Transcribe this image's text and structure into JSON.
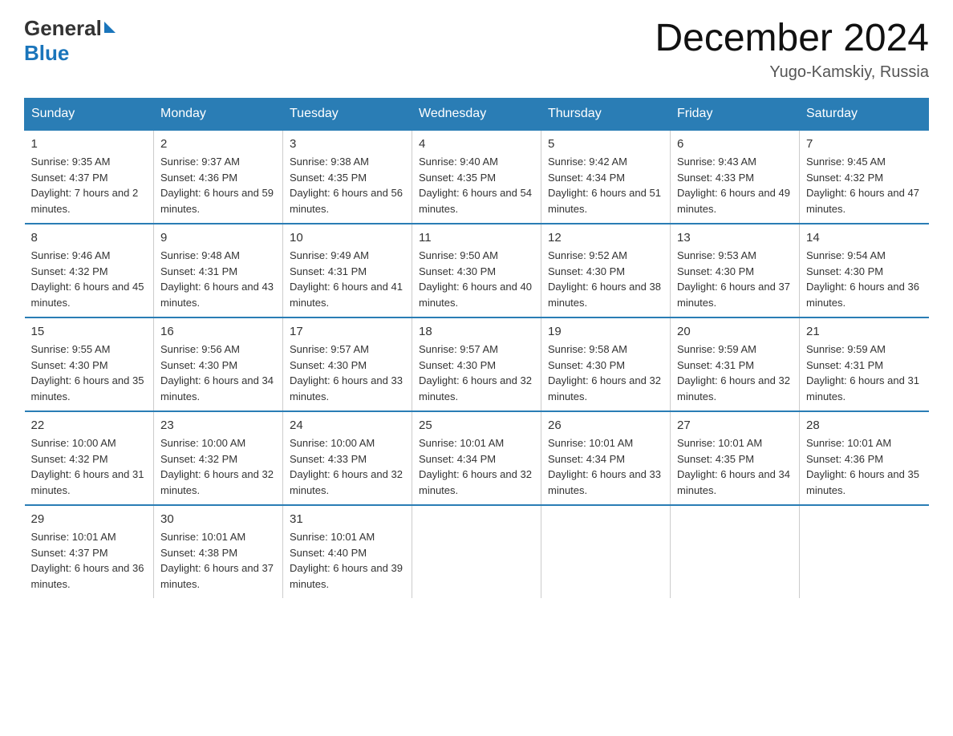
{
  "header": {
    "logo_general": "General",
    "logo_blue": "Blue",
    "month_title": "December 2024",
    "location": "Yugo-Kamskiy, Russia"
  },
  "weekdays": [
    "Sunday",
    "Monday",
    "Tuesday",
    "Wednesday",
    "Thursday",
    "Friday",
    "Saturday"
  ],
  "weeks": [
    [
      {
        "day": "1",
        "sunrise": "9:35 AM",
        "sunset": "4:37 PM",
        "daylight": "7 hours and 2 minutes."
      },
      {
        "day": "2",
        "sunrise": "9:37 AM",
        "sunset": "4:36 PM",
        "daylight": "6 hours and 59 minutes."
      },
      {
        "day": "3",
        "sunrise": "9:38 AM",
        "sunset": "4:35 PM",
        "daylight": "6 hours and 56 minutes."
      },
      {
        "day": "4",
        "sunrise": "9:40 AM",
        "sunset": "4:35 PM",
        "daylight": "6 hours and 54 minutes."
      },
      {
        "day": "5",
        "sunrise": "9:42 AM",
        "sunset": "4:34 PM",
        "daylight": "6 hours and 51 minutes."
      },
      {
        "day": "6",
        "sunrise": "9:43 AM",
        "sunset": "4:33 PM",
        "daylight": "6 hours and 49 minutes."
      },
      {
        "day": "7",
        "sunrise": "9:45 AM",
        "sunset": "4:32 PM",
        "daylight": "6 hours and 47 minutes."
      }
    ],
    [
      {
        "day": "8",
        "sunrise": "9:46 AM",
        "sunset": "4:32 PM",
        "daylight": "6 hours and 45 minutes."
      },
      {
        "day": "9",
        "sunrise": "9:48 AM",
        "sunset": "4:31 PM",
        "daylight": "6 hours and 43 minutes."
      },
      {
        "day": "10",
        "sunrise": "9:49 AM",
        "sunset": "4:31 PM",
        "daylight": "6 hours and 41 minutes."
      },
      {
        "day": "11",
        "sunrise": "9:50 AM",
        "sunset": "4:30 PM",
        "daylight": "6 hours and 40 minutes."
      },
      {
        "day": "12",
        "sunrise": "9:52 AM",
        "sunset": "4:30 PM",
        "daylight": "6 hours and 38 minutes."
      },
      {
        "day": "13",
        "sunrise": "9:53 AM",
        "sunset": "4:30 PM",
        "daylight": "6 hours and 37 minutes."
      },
      {
        "day": "14",
        "sunrise": "9:54 AM",
        "sunset": "4:30 PM",
        "daylight": "6 hours and 36 minutes."
      }
    ],
    [
      {
        "day": "15",
        "sunrise": "9:55 AM",
        "sunset": "4:30 PM",
        "daylight": "6 hours and 35 minutes."
      },
      {
        "day": "16",
        "sunrise": "9:56 AM",
        "sunset": "4:30 PM",
        "daylight": "6 hours and 34 minutes."
      },
      {
        "day": "17",
        "sunrise": "9:57 AM",
        "sunset": "4:30 PM",
        "daylight": "6 hours and 33 minutes."
      },
      {
        "day": "18",
        "sunrise": "9:57 AM",
        "sunset": "4:30 PM",
        "daylight": "6 hours and 32 minutes."
      },
      {
        "day": "19",
        "sunrise": "9:58 AM",
        "sunset": "4:30 PM",
        "daylight": "6 hours and 32 minutes."
      },
      {
        "day": "20",
        "sunrise": "9:59 AM",
        "sunset": "4:31 PM",
        "daylight": "6 hours and 32 minutes."
      },
      {
        "day": "21",
        "sunrise": "9:59 AM",
        "sunset": "4:31 PM",
        "daylight": "6 hours and 31 minutes."
      }
    ],
    [
      {
        "day": "22",
        "sunrise": "10:00 AM",
        "sunset": "4:32 PM",
        "daylight": "6 hours and 31 minutes."
      },
      {
        "day": "23",
        "sunrise": "10:00 AM",
        "sunset": "4:32 PM",
        "daylight": "6 hours and 32 minutes."
      },
      {
        "day": "24",
        "sunrise": "10:00 AM",
        "sunset": "4:33 PM",
        "daylight": "6 hours and 32 minutes."
      },
      {
        "day": "25",
        "sunrise": "10:01 AM",
        "sunset": "4:34 PM",
        "daylight": "6 hours and 32 minutes."
      },
      {
        "day": "26",
        "sunrise": "10:01 AM",
        "sunset": "4:34 PM",
        "daylight": "6 hours and 33 minutes."
      },
      {
        "day": "27",
        "sunrise": "10:01 AM",
        "sunset": "4:35 PM",
        "daylight": "6 hours and 34 minutes."
      },
      {
        "day": "28",
        "sunrise": "10:01 AM",
        "sunset": "4:36 PM",
        "daylight": "6 hours and 35 minutes."
      }
    ],
    [
      {
        "day": "29",
        "sunrise": "10:01 AM",
        "sunset": "4:37 PM",
        "daylight": "6 hours and 36 minutes."
      },
      {
        "day": "30",
        "sunrise": "10:01 AM",
        "sunset": "4:38 PM",
        "daylight": "6 hours and 37 minutes."
      },
      {
        "day": "31",
        "sunrise": "10:01 AM",
        "sunset": "4:40 PM",
        "daylight": "6 hours and 39 minutes."
      },
      null,
      null,
      null,
      null
    ]
  ]
}
